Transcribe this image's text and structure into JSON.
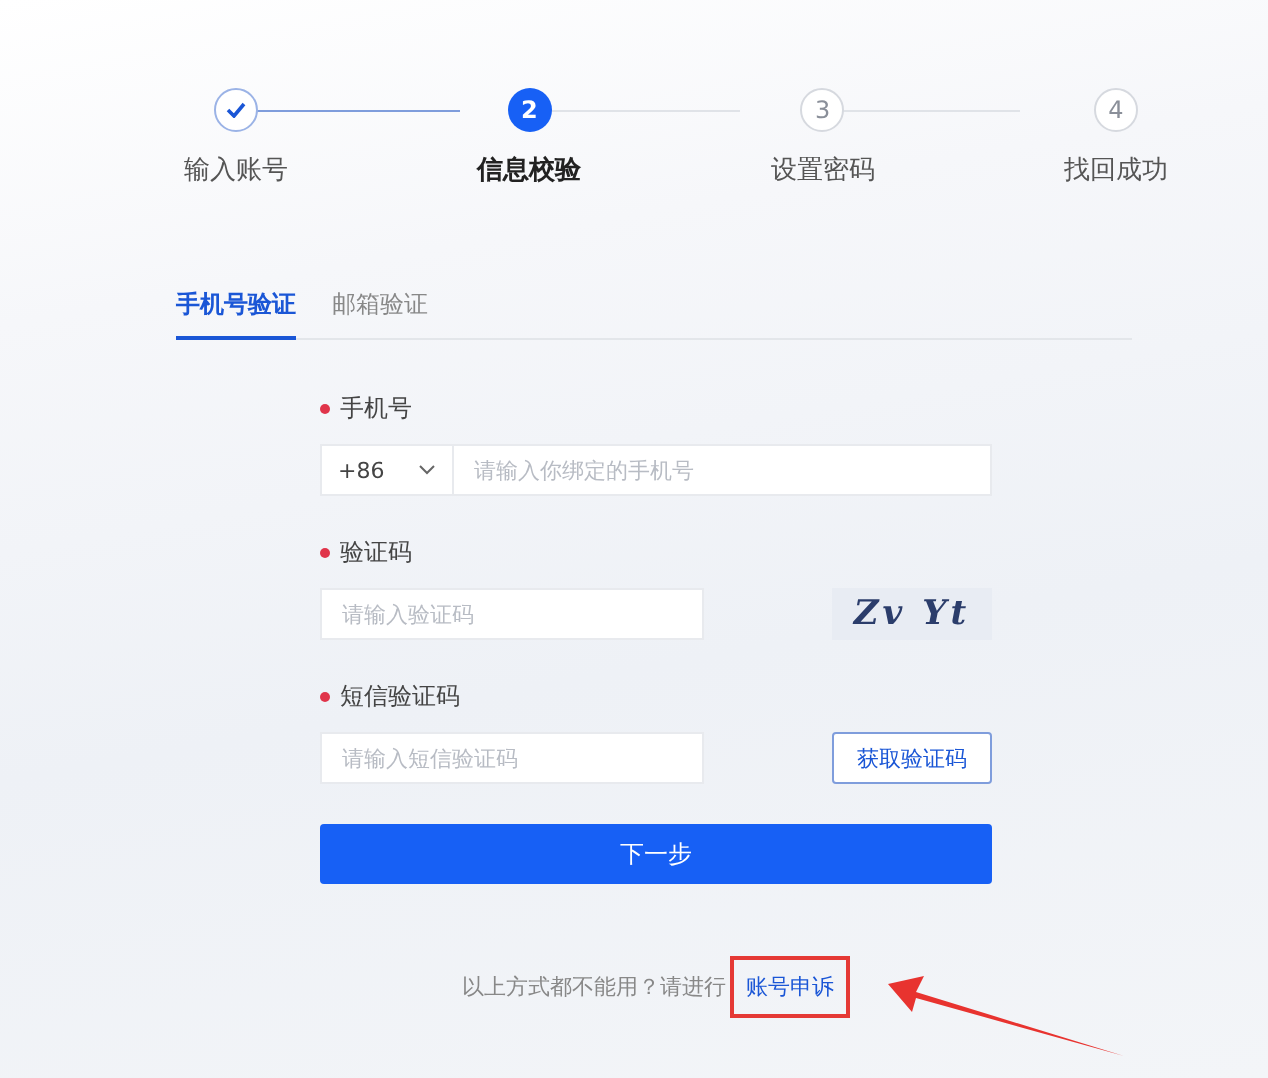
{
  "steps": [
    {
      "label": "输入账号",
      "kind": "done"
    },
    {
      "label": "信息校验",
      "kind": "active",
      "number": "2"
    },
    {
      "label": "设置密码",
      "kind": "pending",
      "number": "3"
    },
    {
      "label": "找回成功",
      "kind": "pending",
      "number": "4"
    }
  ],
  "tabs": [
    {
      "label": "手机号验证",
      "selected": true
    },
    {
      "label": "邮箱验证",
      "selected": false
    }
  ],
  "fields": [
    {
      "kind": "phone",
      "label": "手机号",
      "required": true,
      "country_code": "+86",
      "placeholder": "请输入你绑定的手机号"
    },
    {
      "kind": "captcha",
      "label": "验证码",
      "required": true,
      "placeholder": "请输入验证码",
      "captcha": "Zv Yt"
    },
    {
      "kind": "sms",
      "label": "短信验证码",
      "required": true,
      "placeholder": "请输入短信验证码",
      "button": "获取验证码"
    }
  ],
  "submit": "下一步",
  "footer": {
    "text": "以上方式都不能用？请进行",
    "link": "账号申诉",
    "highlighted": true
  }
}
